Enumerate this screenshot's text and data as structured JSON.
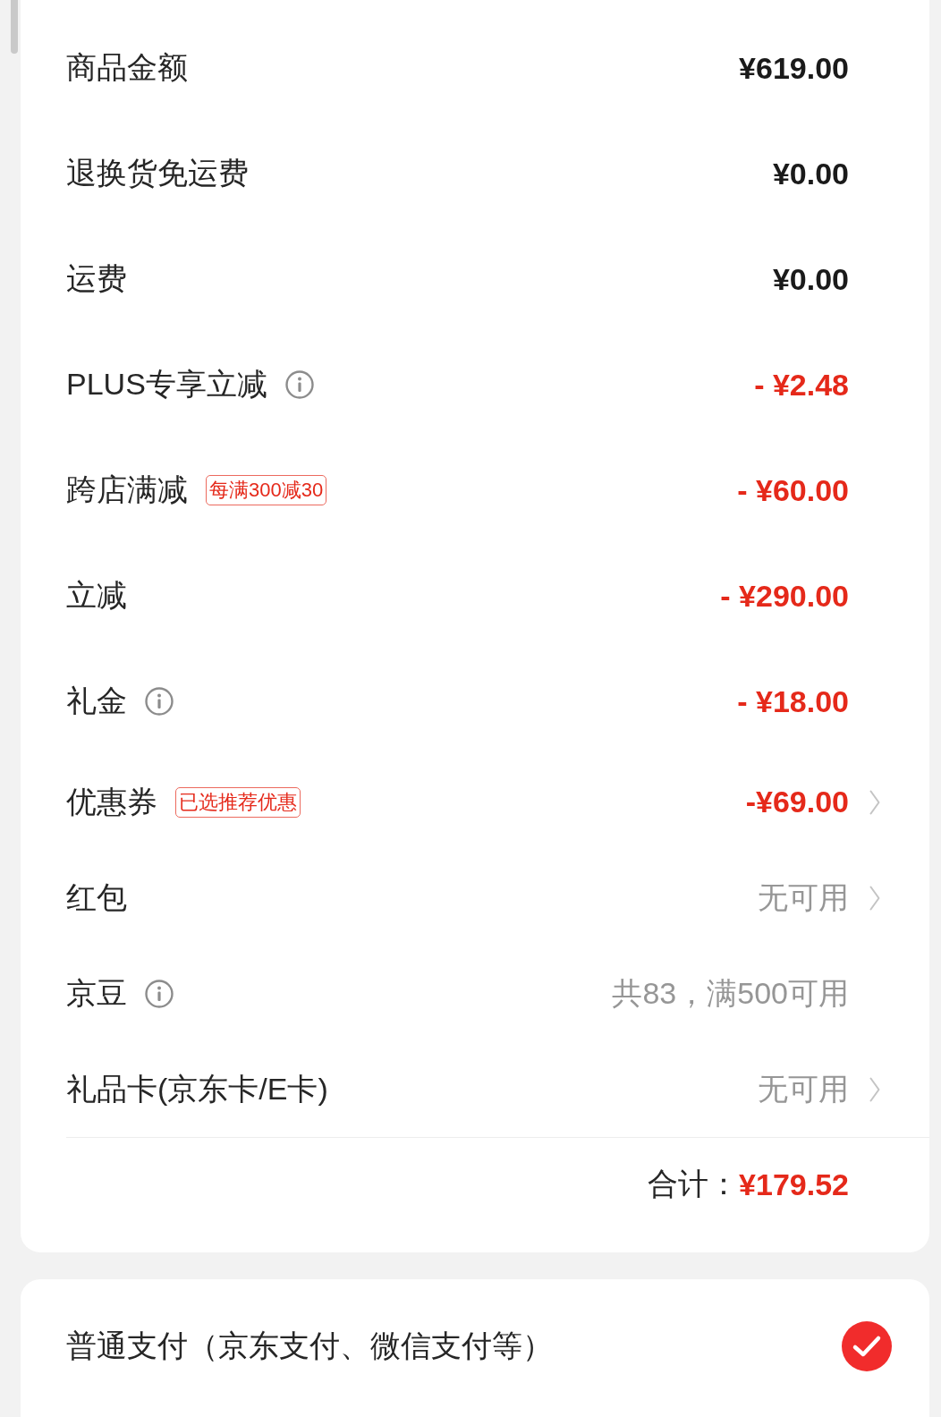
{
  "fees": [
    {
      "kind": "charge",
      "label": "商品金额",
      "value": "¥619.00"
    },
    {
      "kind": "charge",
      "label": "退换货免运费",
      "value": "¥0.00"
    },
    {
      "kind": "charge",
      "label": "运费",
      "value": "¥0.00"
    },
    {
      "kind": "discount",
      "label": "PLUS专享立减",
      "info": true,
      "value": "- ¥2.48"
    },
    {
      "kind": "discount",
      "label": "跨店满减",
      "tag": "每满300减30",
      "value": "- ¥60.00"
    },
    {
      "kind": "discount",
      "label": "立减",
      "value": "- ¥290.00"
    },
    {
      "kind": "discount",
      "label": "礼金",
      "info": true,
      "value": "- ¥18.00"
    },
    {
      "kind": "discount",
      "label": "优惠券",
      "tag": "已选推荐优惠",
      "value": "-¥69.00",
      "arrow": true
    },
    {
      "kind": "status",
      "label": "红包",
      "value": "无可用",
      "arrow": true
    },
    {
      "kind": "status",
      "label": "京豆",
      "info": true,
      "value": "共83，满500可用"
    },
    {
      "kind": "status",
      "label": "礼品卡(京东卡/E卡)",
      "value": "无可用",
      "arrow": true
    }
  ],
  "total": {
    "label": "合计：",
    "value": "¥179.52"
  },
  "payment_options": [
    {
      "label": "普通支付（京东支付、微信支付等）",
      "selected": true
    }
  ]
}
